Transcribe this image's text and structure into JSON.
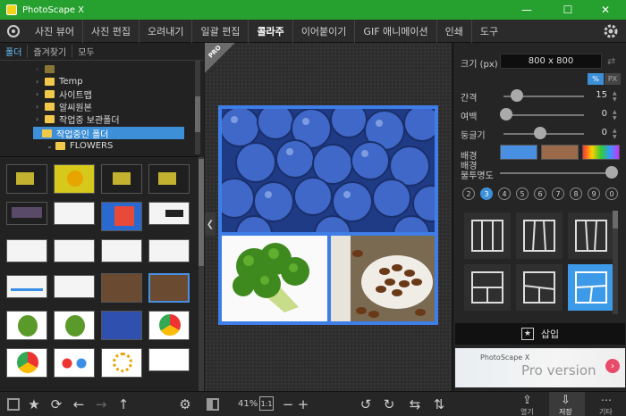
{
  "window": {
    "title": "PhotoScape X",
    "minimize": "—",
    "maximize": "☐",
    "close": "✕"
  },
  "menu": {
    "tabs": [
      "사진 뷰어",
      "사진 편집",
      "오려내기",
      "일괄 편집",
      "콜라주",
      "이어붙이기",
      "GIF 애니메이션",
      "인쇄",
      "도구"
    ],
    "active": "콜라주"
  },
  "left_panel": {
    "tabs": [
      "폴더",
      "즐겨찾기",
      "모두"
    ],
    "tree": [
      {
        "label": "Temp",
        "indent": 1,
        "has_arrow": true
      },
      {
        "label": "사이트맵",
        "indent": 1,
        "has_arrow": true
      },
      {
        "label": "알씨원본",
        "indent": 1,
        "has_arrow": true
      },
      {
        "label": "작업중 보관폴더",
        "indent": 1,
        "has_arrow": true
      },
      {
        "label": "작업중인 폴더",
        "indent": 1,
        "has_arrow": false,
        "selected": true
      },
      {
        "label": "FLOWERS",
        "indent": 2,
        "has_arrow": true
      }
    ]
  },
  "canvas": {
    "pro_badge": "PRO",
    "zoom": "41%",
    "ratio_button": "1:1",
    "minus": "−",
    "plus": "+"
  },
  "right_panel": {
    "size_label": "크기 (px)",
    "size_value": "800 x 800",
    "unit_percent": "%",
    "unit_px": "PX",
    "spacing": {
      "label": "간격",
      "value": "15"
    },
    "margin": {
      "label": "여백",
      "value": "0"
    },
    "round": {
      "label": "둥글기",
      "value": "0"
    },
    "background": {
      "label": "배경"
    },
    "bg_opacity": {
      "label": "배경\n불투명도"
    },
    "counts": [
      "2",
      "3",
      "4",
      "5",
      "6",
      "7",
      "8",
      "9",
      "0"
    ],
    "active_count": "3",
    "insert_label": "삽입",
    "banner_small": "PhotoScape X",
    "banner_big": "Pro version",
    "colors": {
      "swatch_blue": "#4a90e2",
      "swatch_brown": "#9b6a4a",
      "accent": "#3d8fd8"
    }
  },
  "bottom": {
    "open_label": "열기",
    "save_label": "저장",
    "more_label": "기타"
  }
}
